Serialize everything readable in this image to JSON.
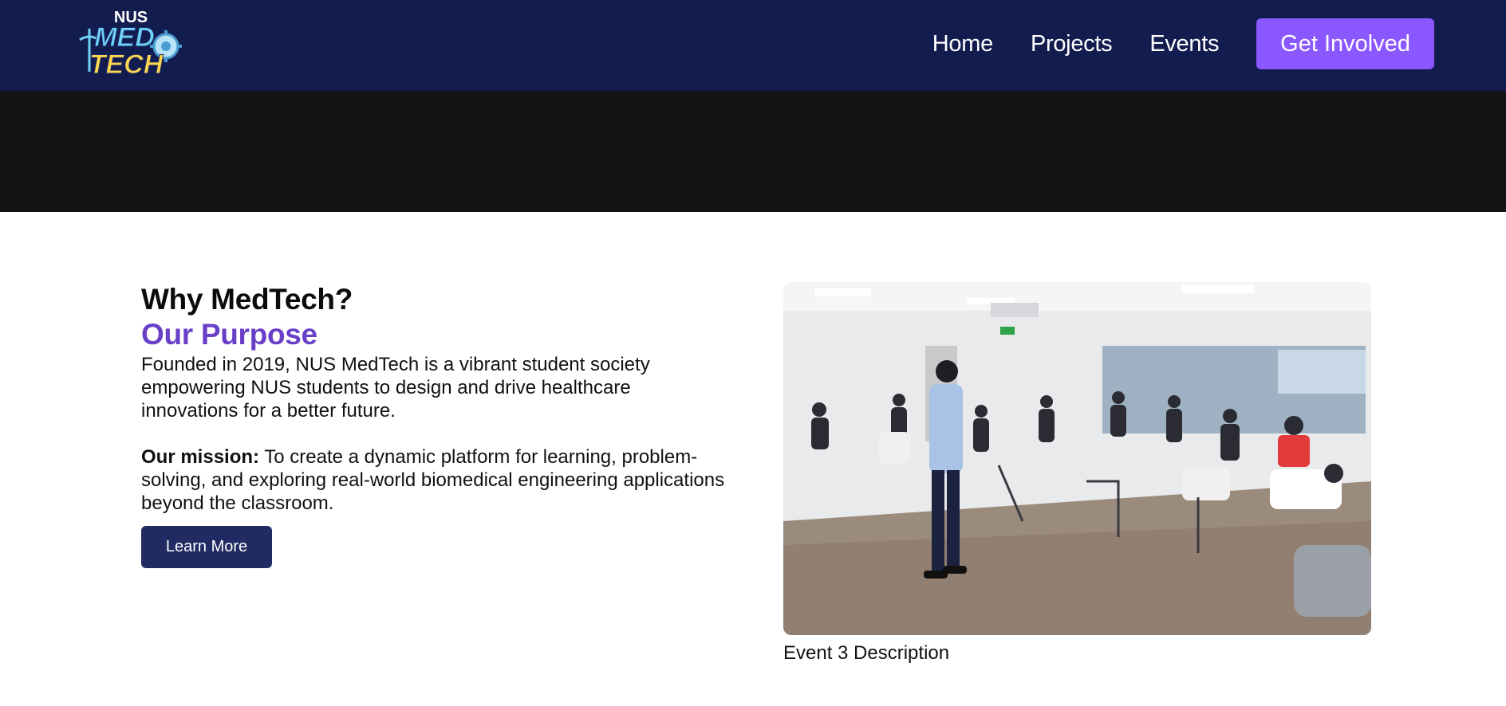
{
  "brand": {
    "logo_text_top": "NUS",
    "logo_text_mid": "MED",
    "logo_text_bottom": "TECH"
  },
  "nav": {
    "links": [
      "Home",
      "Projects",
      "Events"
    ],
    "cta_label": "Get Involved"
  },
  "about": {
    "heading": "Why MedTech?",
    "subheading": "Our Purpose",
    "intro": "Founded in 2019, NUS MedTech is a vibrant student society empowering NUS students to design and drive healthcare innovations for a better future.",
    "mission_label": "Our mission:",
    "mission_text": " To create a dynamic platform for learning, problem-solving, and exploring real-world biomedical engineering applications beyond the classroom.",
    "button_label": "Learn More"
  },
  "event": {
    "caption": "Event 3 Description"
  },
  "colors": {
    "navbar_bg": "#131c4e",
    "cta_bg": "#8b57ff",
    "accent_purple": "#6a3fc8",
    "button_bg": "#212b63",
    "hero_bg": "#141414"
  }
}
